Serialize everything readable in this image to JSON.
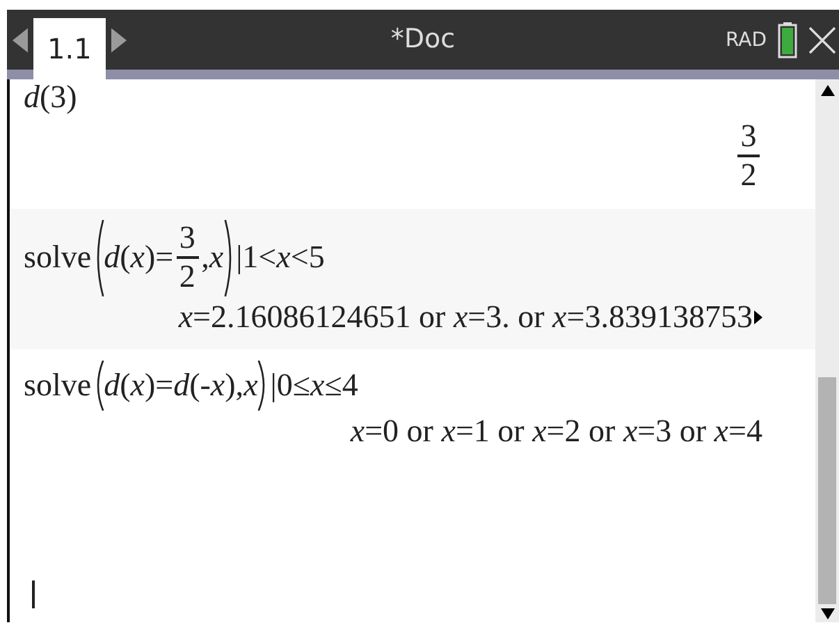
{
  "header": {
    "tabs": [
      {
        "label": "1.1",
        "selected": true
      }
    ],
    "title": "*Doc",
    "mode": "RAD"
  },
  "history": [
    {
      "input": [
        {
          "kind": "text",
          "text": "*d*(3)"
        }
      ],
      "result": [
        {
          "kind": "frac",
          "num": "3",
          "den": "2"
        }
      ],
      "shaded": false
    },
    {
      "input": [
        {
          "kind": "text",
          "text": "solve"
        },
        {
          "kind": "group",
          "children": [
            {
              "kind": "text",
              "text": "*d*(*x*)="
            },
            {
              "kind": "frac",
              "num": "3",
              "den": "2"
            },
            {
              "kind": "text",
              "text": ",*x*"
            }
          ]
        },
        {
          "kind": "text",
          "text": "|1<*x*<5"
        }
      ],
      "result": [
        {
          "kind": "text",
          "text": "*x*=2.16086124651 or *x*=3. or *x*=3.839138753"
        }
      ],
      "truncated": true,
      "shaded": true
    },
    {
      "input": [
        {
          "kind": "text",
          "text": "solve"
        },
        {
          "kind": "group",
          "children": [
            {
              "kind": "text",
              "text": "*d*(*x*)=*d*(-*x*),*x*"
            }
          ]
        },
        {
          "kind": "text",
          "text": "|0≤*x*≤4"
        }
      ],
      "result": [
        {
          "kind": "text",
          "text": "*x*=0 or *x*=1 or *x*=2 or *x*=3 or *x*=4"
        }
      ],
      "shaded": false
    }
  ]
}
